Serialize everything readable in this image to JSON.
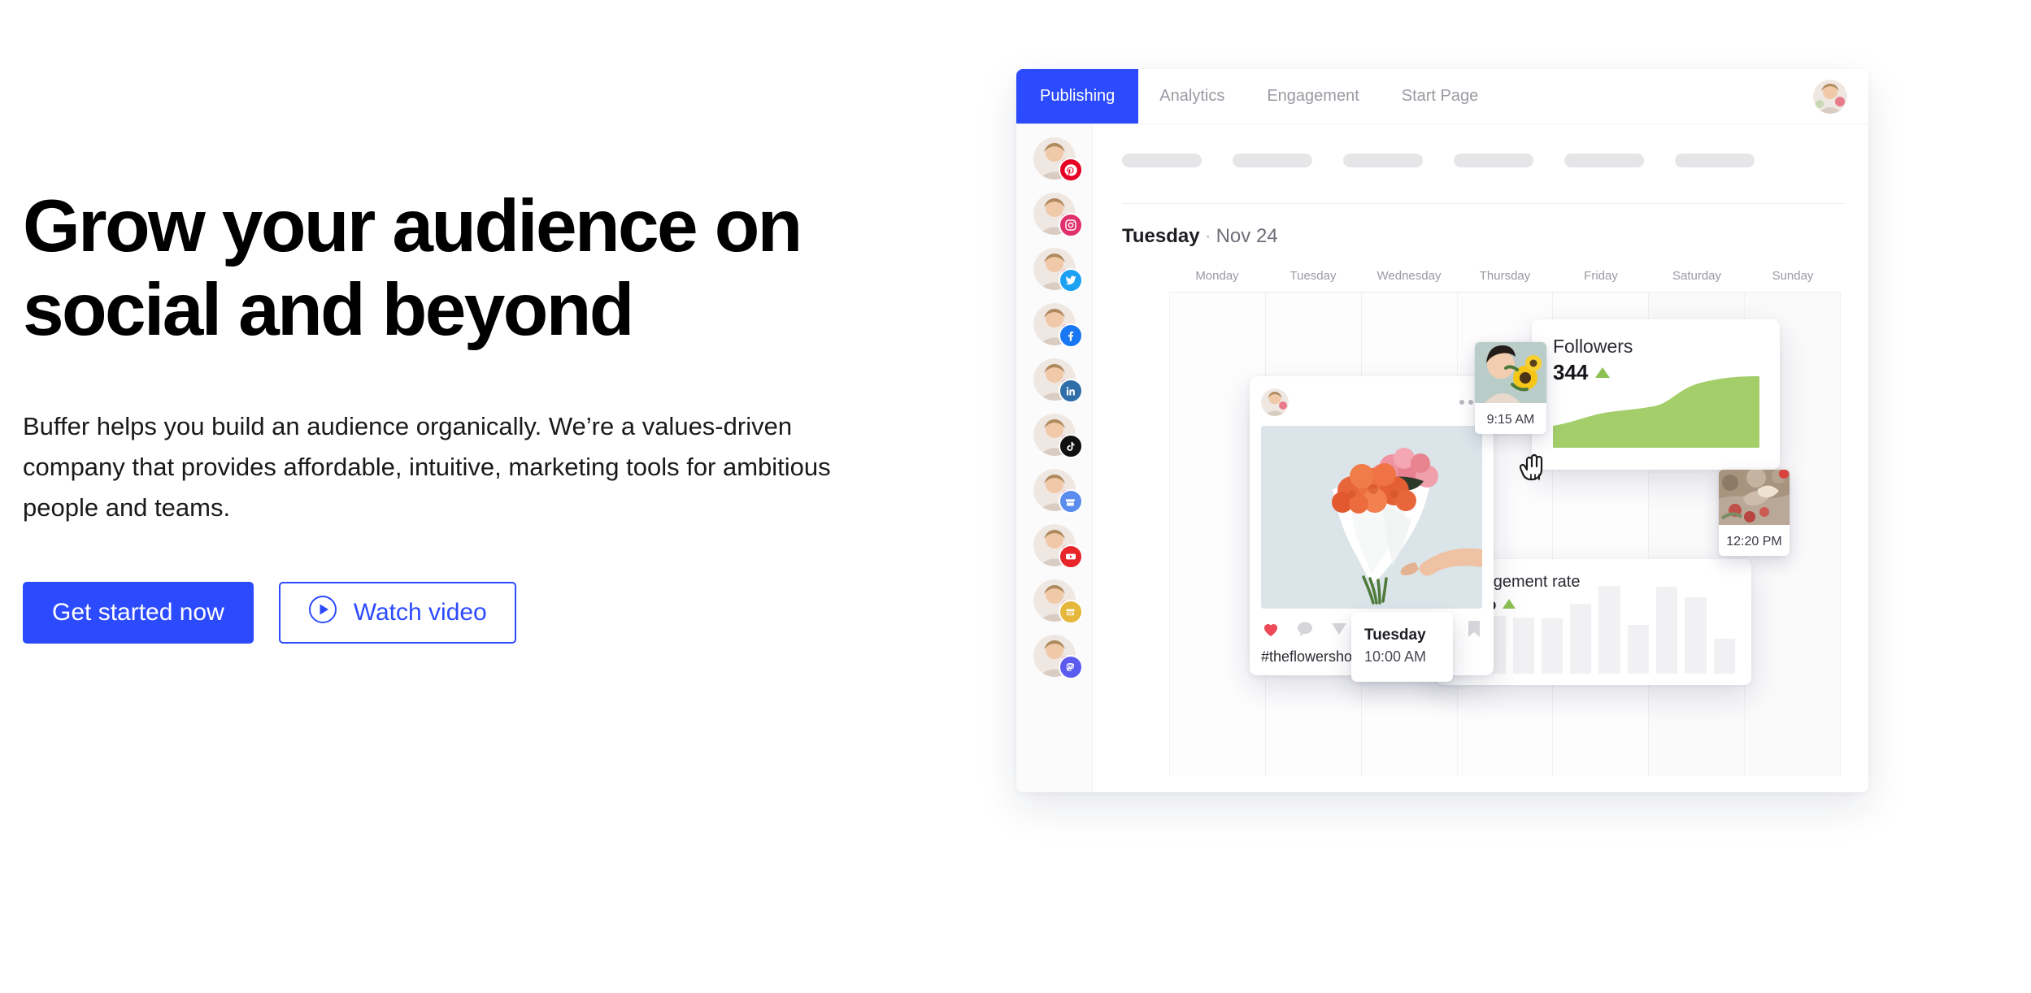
{
  "hero": {
    "title": "Grow your audience on social and beyond",
    "subtitle": "Buffer helps you build an audience organically. We’re a values-driven company that provides affordable, intuitive, marketing tools for ambitious people and teams.",
    "primary_cta": "Get started now",
    "secondary_cta": "Watch video"
  },
  "colors": {
    "brand_blue": "#2c4bff",
    "green": "#8cc152",
    "heart_red": "#ed4956",
    "text_black": "#000000"
  },
  "app": {
    "tabs": [
      {
        "label": "Publishing",
        "active": true
      },
      {
        "label": "Analytics",
        "active": false
      },
      {
        "label": "Engagement",
        "active": false
      },
      {
        "label": "Start Page",
        "active": false
      }
    ],
    "toolbar_pills": 6,
    "channels": [
      {
        "network": "pinterest",
        "color": "#e60023",
        "glyph": "P"
      },
      {
        "network": "instagram",
        "color": "#e1306c",
        "glyph": "◉"
      },
      {
        "network": "twitter",
        "color": "#1da1f2",
        "glyph": "t"
      },
      {
        "network": "facebook",
        "color": "#1877f2",
        "glyph": "f"
      },
      {
        "network": "linkedin",
        "color": "#2f6fa8",
        "glyph": "in"
      },
      {
        "network": "tiktok",
        "color": "#111111",
        "glyph": "♪"
      },
      {
        "network": "google-business",
        "color": "#5b8def",
        "glyph": "▤"
      },
      {
        "network": "youtube",
        "color": "#e8262a",
        "glyph": "▶"
      },
      {
        "network": "shopify",
        "color": "#e5b73b",
        "glyph": "▤"
      },
      {
        "network": "mastodon",
        "color": "#5b5bef",
        "glyph": "m"
      }
    ],
    "calendar": {
      "day_name": "Tuesday",
      "separator": "·",
      "date": "Nov 24",
      "weekdays": [
        "Monday",
        "Tuesday",
        "Wednesday",
        "Thursday",
        "Friday",
        "Saturday",
        "Sunday"
      ]
    },
    "post_card": {
      "caption": "#theflowershop",
      "actions": [
        "like",
        "comment",
        "share",
        "bookmark"
      ],
      "liked": true,
      "menu": "more-options"
    },
    "scheduled_thumbs": [
      {
        "time": "9:15 AM"
      },
      {
        "time": "12:20 PM"
      }
    ],
    "tooltip": {
      "day": "Tuesday",
      "time": "10:00 AM"
    },
    "followers_card": {
      "label": "Followers",
      "value": "344",
      "trend": "up"
    },
    "engagement_card": {
      "label": "Engagement rate",
      "value": "5.0%",
      "trend": "up"
    }
  },
  "chart_data": [
    {
      "type": "area",
      "title": "Followers",
      "value_label": "344",
      "x": [
        0,
        1,
        2,
        3,
        4,
        5,
        6,
        7,
        8
      ],
      "values": [
        30,
        42,
        50,
        54,
        56,
        62,
        82,
        95,
        98
      ],
      "ylim": [
        0,
        100
      ],
      "color": "#a3ce6a",
      "grid": false,
      "legend": "none",
      "xlabel": "",
      "ylabel": ""
    },
    {
      "type": "bar",
      "title": "Engagement rate",
      "value_label": "5.0%",
      "categories": [
        "1",
        "2",
        "3",
        "4",
        "5",
        "6",
        "7",
        "8",
        "9",
        "10"
      ],
      "values": [
        42,
        66,
        64,
        63,
        80,
        100,
        56,
        99,
        87,
        40
      ],
      "ylim": [
        0,
        100
      ],
      "color": "#f1f1f3",
      "grid": false,
      "legend": "none",
      "xlabel": "",
      "ylabel": ""
    }
  ]
}
